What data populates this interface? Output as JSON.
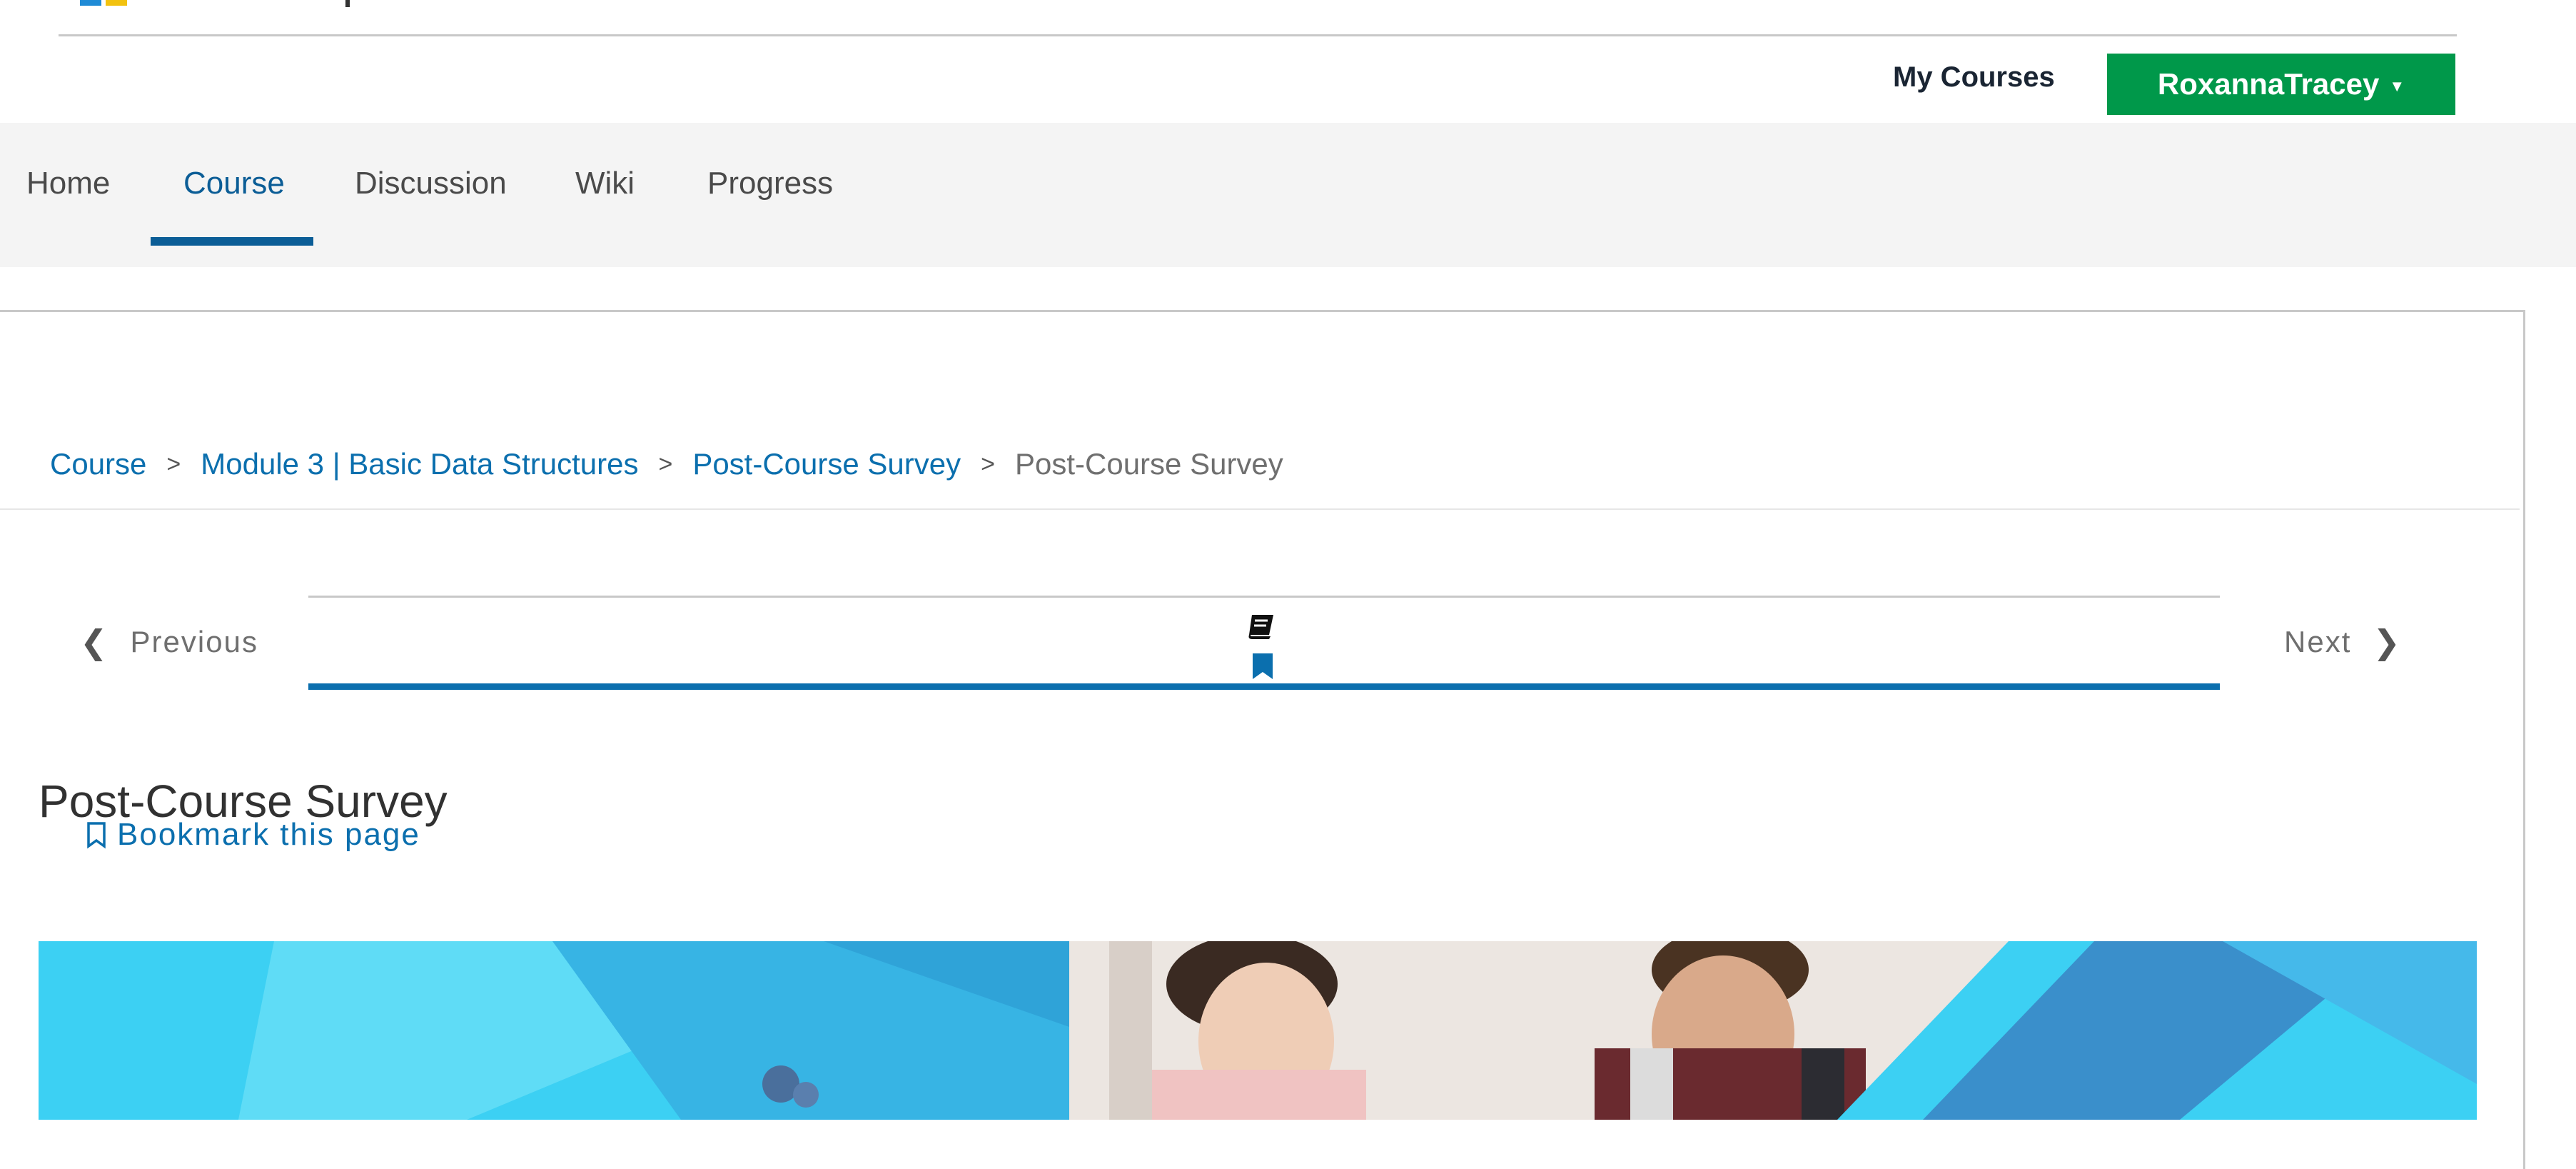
{
  "header": {
    "my_courses_label": "My Courses",
    "username": "RoxannaTracey",
    "user_menu_color": "#00984a"
  },
  "course_nav": {
    "tabs": [
      {
        "label": "Home"
      },
      {
        "label": "Course",
        "active": true
      },
      {
        "label": "Discussion"
      },
      {
        "label": "Wiki"
      },
      {
        "label": "Progress"
      }
    ],
    "active_color": "#0b5d96"
  },
  "breadcrumb": {
    "items": [
      "Course",
      "Module 3 | Basic Data Structures",
      "Post-Course Survey"
    ],
    "current": "Post-Course Survey"
  },
  "sequence_nav": {
    "previous_label": "Previous",
    "next_label": "Next",
    "unit_icon": "book-icon",
    "bookmarked": true
  },
  "unit": {
    "title": "Post-Course Survey",
    "bookmark_label": "Bookmark this page"
  }
}
